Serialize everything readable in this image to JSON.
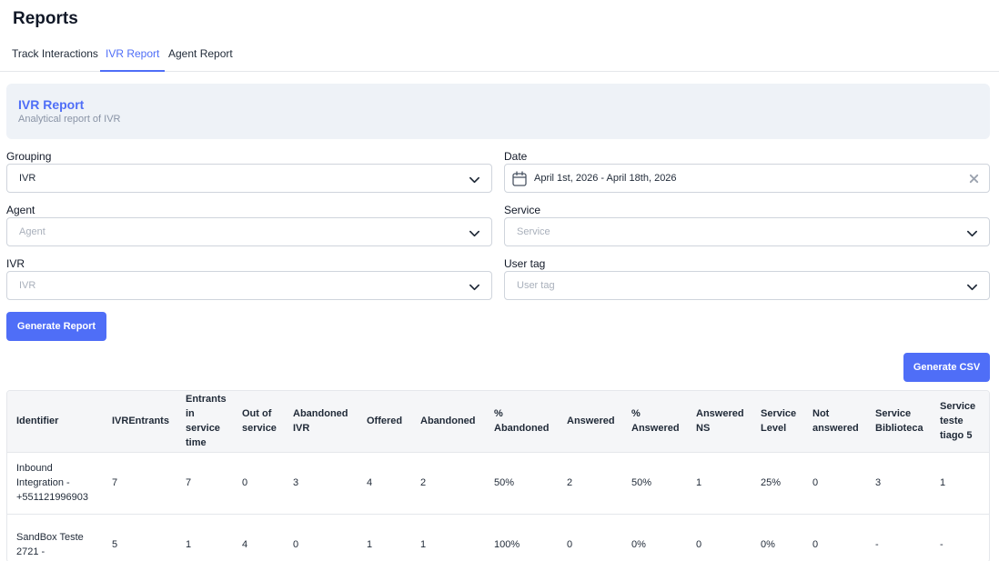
{
  "page": {
    "title": "Reports"
  },
  "tabs": [
    {
      "label": "Track Interactions",
      "active": false
    },
    {
      "label": "IVR Report",
      "active": true
    },
    {
      "label": "Agent Report",
      "active": false
    }
  ],
  "banner": {
    "title": "IVR Report",
    "subtitle": "Analytical report of IVR"
  },
  "filters": {
    "grouping": {
      "label": "Grouping",
      "value": "IVR"
    },
    "date": {
      "label": "Date",
      "value": "April 1st, 2026 - April 18th, 2026"
    },
    "agent": {
      "label": "Agent",
      "placeholder": "Agent"
    },
    "service": {
      "label": "Service",
      "placeholder": "Service"
    },
    "ivr": {
      "label": "IVR",
      "placeholder": "IVR"
    },
    "user_tag": {
      "label": "User tag",
      "placeholder": "User tag"
    }
  },
  "actions": {
    "generate_report": "Generate Report",
    "generate_csv": "Generate CSV"
  },
  "colors": {
    "accent": "#4f6ef7",
    "banner_bg": "#eef2f7",
    "header_bg": "#f5f6f8"
  },
  "table": {
    "headers": [
      "Identifier",
      "IVREntrants",
      "Entrants in service time",
      "Out of service",
      "Abandoned IVR",
      "Offered",
      "Abandoned",
      "% Abandoned",
      "Answered",
      "% Answered",
      "Answered NS",
      "Service Level",
      "Not answered",
      "Service Biblioteca",
      "Service teste tiago 5"
    ],
    "rows": [
      [
        "Inbound Integration - +551121996903",
        "7",
        "7",
        "0",
        "3",
        "4",
        "2",
        "50%",
        "2",
        "50%",
        "1",
        "25%",
        "0",
        "3",
        "1"
      ],
      [
        "SandBox Teste 2721 -",
        "5",
        "1",
        "4",
        "0",
        "1",
        "1",
        "100%",
        "0",
        "0%",
        "0",
        "0%",
        "0",
        "-",
        "-"
      ]
    ]
  }
}
